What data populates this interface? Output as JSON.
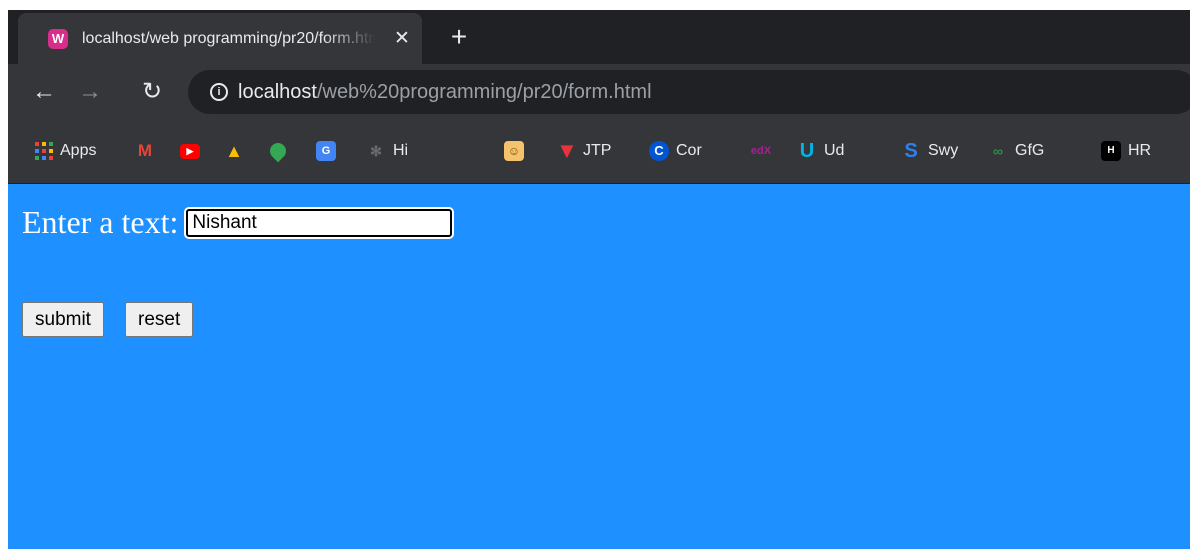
{
  "browser": {
    "tab_title": "localhost/web programming/pr20/form.html",
    "tab_favicon": "wamp-server-icon",
    "url_host": "localhost",
    "url_path": "/web%20programming/pr20/form.html"
  },
  "bookmarks": [
    {
      "label": "Apps",
      "icon": "apps-grid-icon"
    },
    {
      "label": "",
      "icon": "gmail-icon"
    },
    {
      "label": "",
      "icon": "youtube-icon"
    },
    {
      "label": "",
      "icon": "google-drive-icon"
    },
    {
      "label": "",
      "icon": "google-maps-icon"
    },
    {
      "label": "",
      "icon": "google-translate-icon"
    },
    {
      "label": "Hi",
      "icon": "hi-bookmark-icon"
    },
    {
      "label": "",
      "icon": "avatar-bookmark-icon"
    },
    {
      "label": "JTP",
      "icon": "javatpoint-icon"
    },
    {
      "label": "Cor",
      "icon": "coursera-icon"
    },
    {
      "label": "",
      "icon": "edx-icon"
    },
    {
      "label": "Ud",
      "icon": "udacity-icon"
    },
    {
      "label": "Swy",
      "icon": "swayam-icon"
    },
    {
      "label": "GfG",
      "icon": "geeksforgeeks-icon"
    },
    {
      "label": "HR",
      "icon": "hackerrank-icon"
    }
  ],
  "page": {
    "prompt_label": "Enter a text:",
    "text_value": "Nishant",
    "submit_label": "submit",
    "reset_label": "reset",
    "background_color": "#1e90ff"
  }
}
